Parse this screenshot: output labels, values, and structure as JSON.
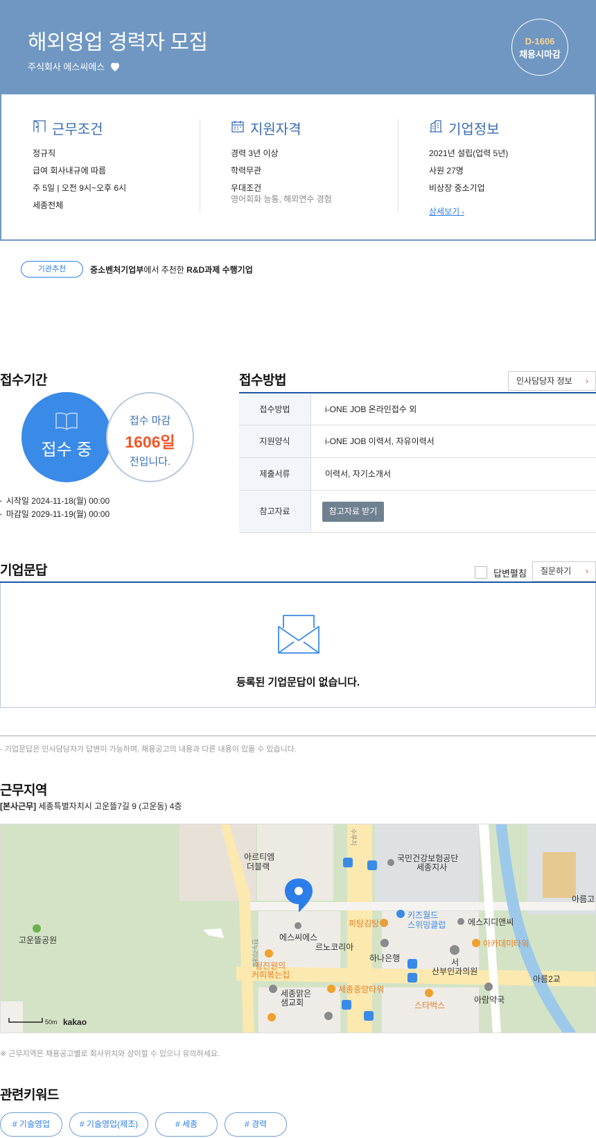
{
  "header": {
    "title": "해외영업 경력자 모집",
    "company": "주식회사 에스씨에스",
    "dday": "D-1606",
    "deadline_type": "채용시마감"
  },
  "info": {
    "work": {
      "title": "근무조건",
      "lines": [
        "정규직",
        "급여 회사내규에 따름",
        "주 5일 | 오전 9시~오후 6시",
        "세종전체"
      ]
    },
    "qualify": {
      "title": "지원자격",
      "lines": [
        "경력 3년 이상",
        "학력무관",
        "우대조건"
      ],
      "sub": "영어회화 능통, 해외연수 경험"
    },
    "company": {
      "title": "기업정보",
      "lines": [
        "2021년 설립(업력 5년)",
        "사원 27명",
        "비상장 중소기업"
      ],
      "detail_link": "상세보기"
    }
  },
  "recommend": {
    "badge": "기관추천",
    "agency": "중소벤처기업부",
    "mid": "에서 추천한 ",
    "tag": "R&D과제 수행기업"
  },
  "period": {
    "title": "접수기간",
    "status": "접수 중",
    "remain_label": "접수 마감",
    "remain_days": "1606일",
    "remain_suffix": "전입니다.",
    "start": "시작일 2024-11-18(월) 00:00",
    "end": "마감일 2029-11-19(월) 00:00"
  },
  "method": {
    "title": "접수방법",
    "hr_button": "인사담당자 정보",
    "rows": [
      {
        "k": "접수방법",
        "v": "i-ONE JOB 온라인접수 외"
      },
      {
        "k": "지원양식",
        "v": "i-ONE JOB 이력서, 자유이력서"
      },
      {
        "k": "제출서류",
        "v": "이력서, 자기소개서"
      },
      {
        "k": "참고자료",
        "v": "참고자료 받기"
      }
    ]
  },
  "qa": {
    "title": "기업문답",
    "toggle_label": "답변펼침",
    "ask_button": "질문하기",
    "empty": "등록된 기업문답이 없습니다.",
    "note": "- 기업문답은 인사담당자가 답변이 가능하며, 채용공고의 내용과 다른 내용이 있을 수 있습니다."
  },
  "location": {
    "title": "근무지역",
    "tag": "[본사근무]",
    "address": "세종특별자치시 고운뜰7길 9 (고운동) 4층",
    "note": "※ 근무지역은 채용공고별로 회사위치와 상이할 수 있으니 유의하세요.",
    "map_labels": {
      "park": "고운뜰공원",
      "arti": "아르티엠",
      "arti2": "더블랙",
      "nhis": "국민건강보험공단",
      "nhis2": "세종지사",
      "kids": "키즈월드",
      "kids2": "스위밍클럽",
      "scs": "에스씨에스",
      "leno": "르노코리아",
      "pitang": "피탕김탕",
      "esg": "에스지디앤씨",
      "hana": "하나은행",
      "academy": "아카데미타워",
      "seo": "서",
      "sanbu": "산부인과의원",
      "coffee": "정진원의",
      "coffee2": "커피볶는집",
      "tower": "세종중앙타워",
      "church": "세종맑은",
      "church2": "샘교회",
      "starbucks": "스타벅스",
      "pharmacy": "아람약국",
      "bridge": "아름2교",
      "areum": "아름고",
      "road1": "한누리대로",
      "road2": "수루지",
      "scale": "50m",
      "kakao": "kakao"
    }
  },
  "keywords": {
    "title": "관련키워드",
    "items": [
      "# 기술영업",
      "# 기술영업(제조)",
      "# 세종",
      "# 경력"
    ]
  },
  "colors": {
    "hero": "#7097c2",
    "accent": "#2b7de9",
    "deadline": "#f0562b"
  }
}
